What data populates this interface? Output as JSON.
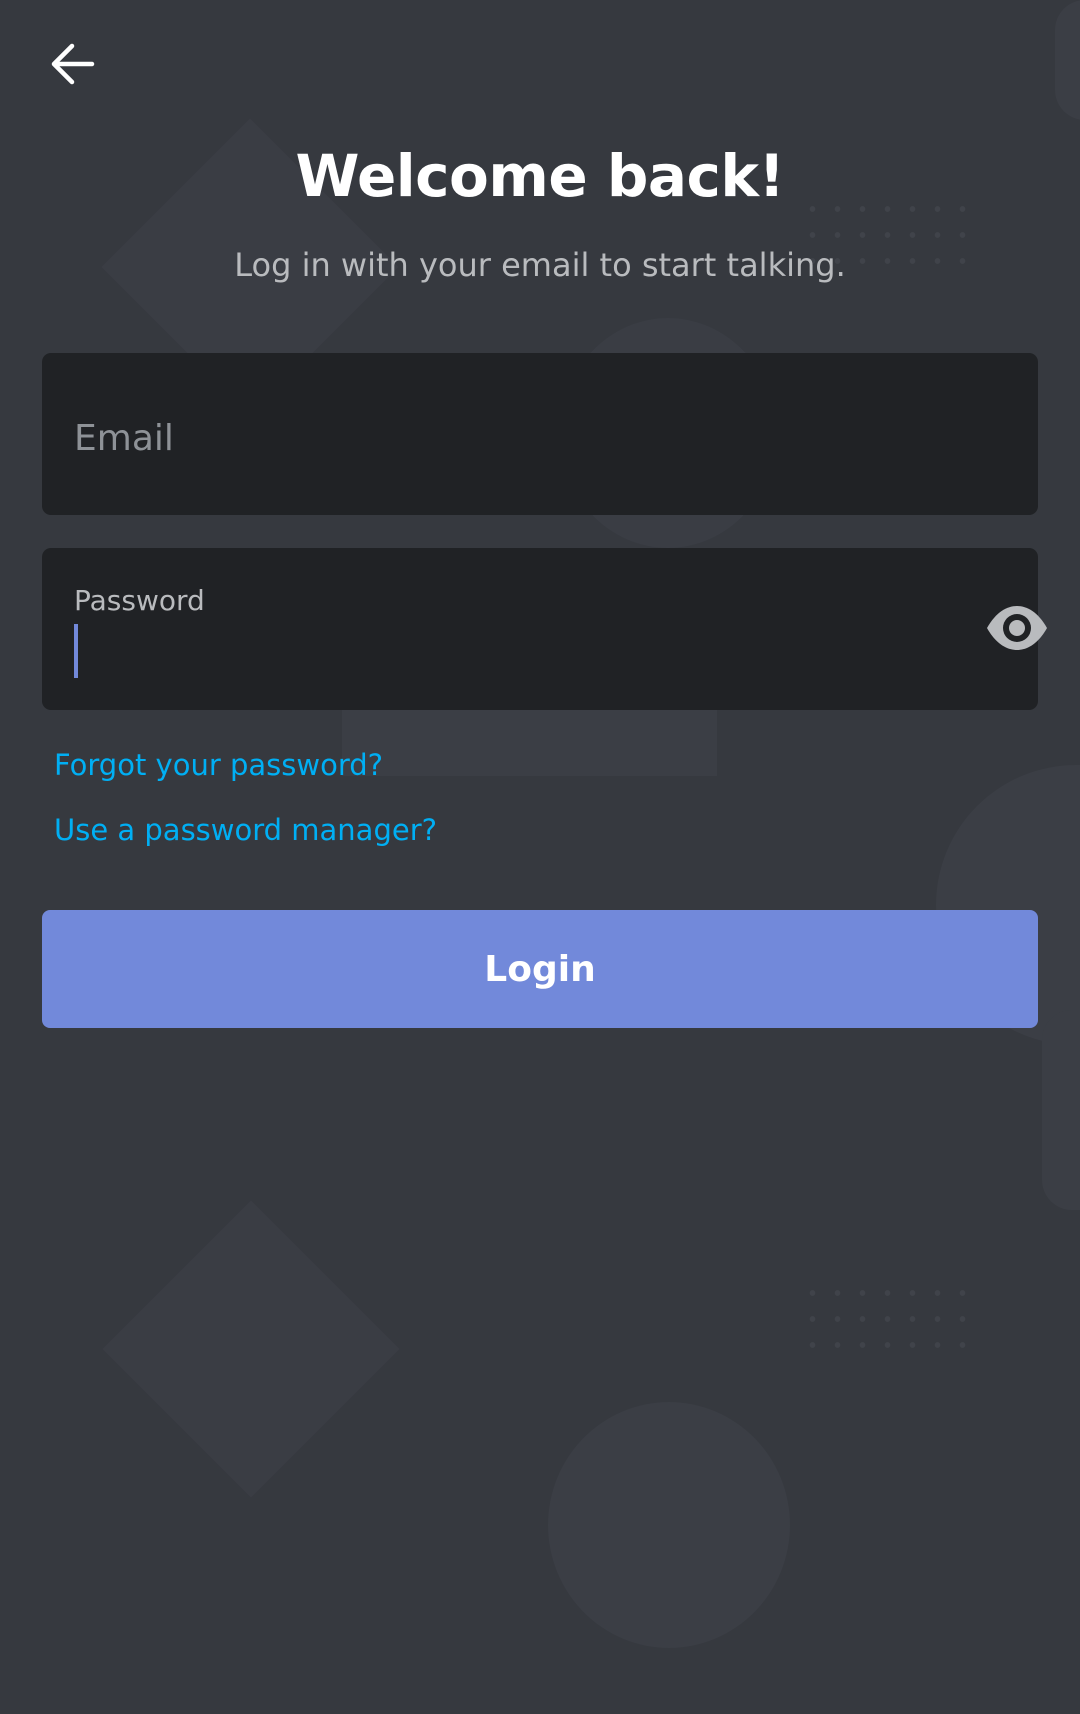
{
  "header": {
    "back_icon": "arrow-left-icon",
    "title": "Welcome back!",
    "subtitle": "Log in with your email to start talking."
  },
  "form": {
    "email": {
      "value": "",
      "placeholder": "Email"
    },
    "password": {
      "label": "Password",
      "value": "",
      "toggle_icon": "eye-icon"
    },
    "forgot_password_link": "Forgot your password?",
    "password_manager_link": "Use a password manager?",
    "login_button": "Login"
  },
  "colors": {
    "background": "#36393f",
    "field_background": "#202225",
    "accent": "#7289da",
    "link": "#00aff4",
    "text_primary": "#ffffff",
    "text_secondary": "#b9bbbe"
  }
}
